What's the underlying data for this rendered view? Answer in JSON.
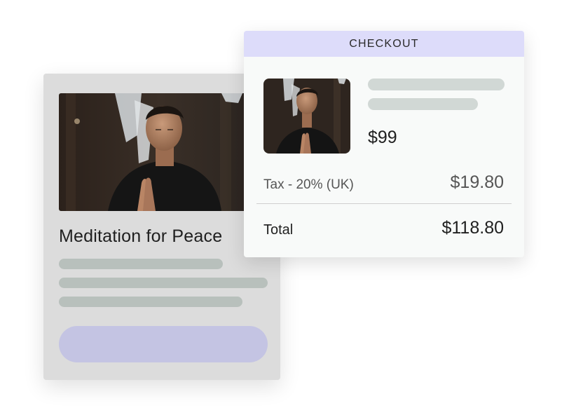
{
  "product_card": {
    "title": "Meditation for Peace",
    "image_alt": "man meditating with hands in prayer"
  },
  "checkout": {
    "header": "CHECKOUT",
    "price": "$99",
    "tax_label": "Tax - 20% (UK)",
    "tax_amount": "$19.80",
    "total_label": "Total",
    "total_amount": "$118.80"
  },
  "colors": {
    "checkout_header_bg": "#dddcfa",
    "cta_pill": "#c4c4e3",
    "card_bg": "#dcdcdc",
    "skeleton": "#b8c0bc"
  }
}
